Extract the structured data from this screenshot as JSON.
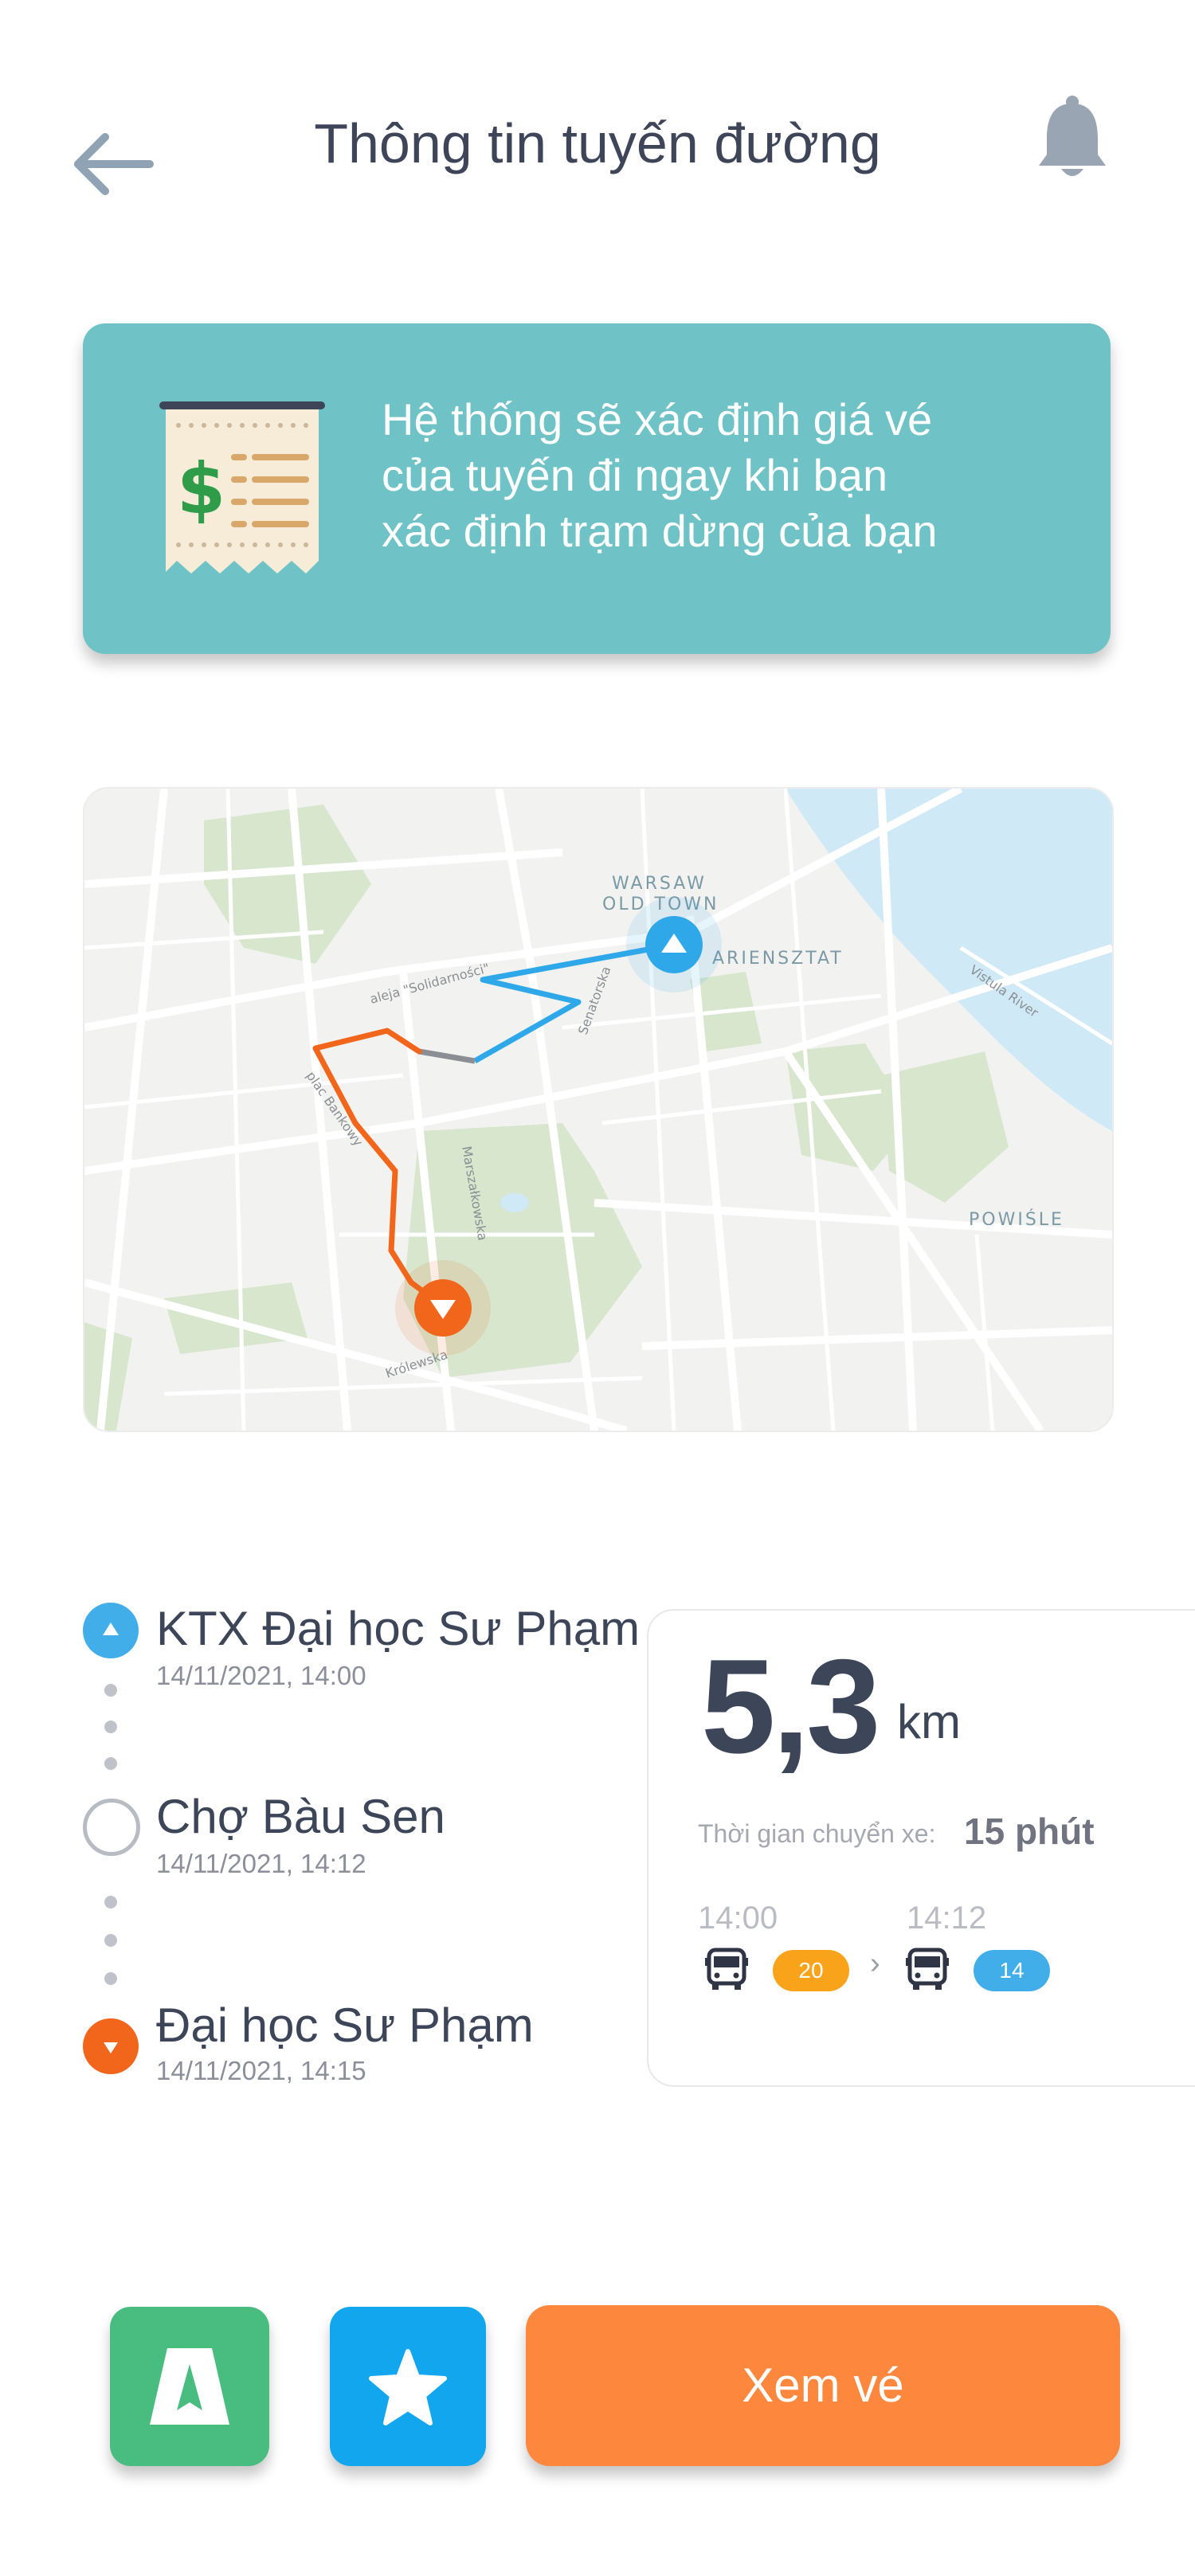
{
  "header": {
    "title": "Thông tin tuyến đường",
    "back_icon": "arrow-left-icon",
    "bell_icon": "bell-icon"
  },
  "info_card": {
    "icon": "receipt-icon",
    "text": "Hệ thống sẽ xác định giá vé của tuyến đi ngay khi bạn xác định trạm dừng của bạn",
    "background": "#6fc3c6"
  },
  "map": {
    "labels": {
      "old_town_1": "WARSAW",
      "old_town_2": "OLD TOWN",
      "mariensztat": "ARIENSZTAT",
      "powisle": "POWIŚLE",
      "vistula": "Vistula River",
      "solidarnosci": "aleja \"Solidarności\"",
      "krolewska": "Królewska",
      "bankowy": "plac Bankowy",
      "marszalkowska": "Marszałkowska",
      "senatorska": "Senatorska"
    },
    "start_color": "#2fa8ea",
    "end_color": "#f2661b"
  },
  "route": {
    "stops": [
      {
        "name": "KTX Đại học Sư Phạm",
        "time": "14/11/2021, 14:00",
        "marker": "start"
      },
      {
        "name": "Chợ Bàu Sen",
        "time": "14/11/2021, 14:12",
        "marker": "intermediate"
      },
      {
        "name": "Đại học Sư Phạm",
        "time": "14/11/2021, 14:15",
        "marker": "end"
      }
    ]
  },
  "summary": {
    "distance_value": "5,3",
    "distance_unit": "km",
    "duration_label": "Thời gian chuyển xe:",
    "duration_value": "15 phút",
    "legs": [
      {
        "time": "14:00",
        "bus": "20",
        "color": "#f9a31b"
      },
      {
        "time": "14:12",
        "bus": "14",
        "color": "#41aeea"
      }
    ],
    "separator": "›"
  },
  "actions": {
    "nav_icon": "road-icon",
    "fav_icon": "star-icon",
    "ticket_label": "Xem vé"
  }
}
